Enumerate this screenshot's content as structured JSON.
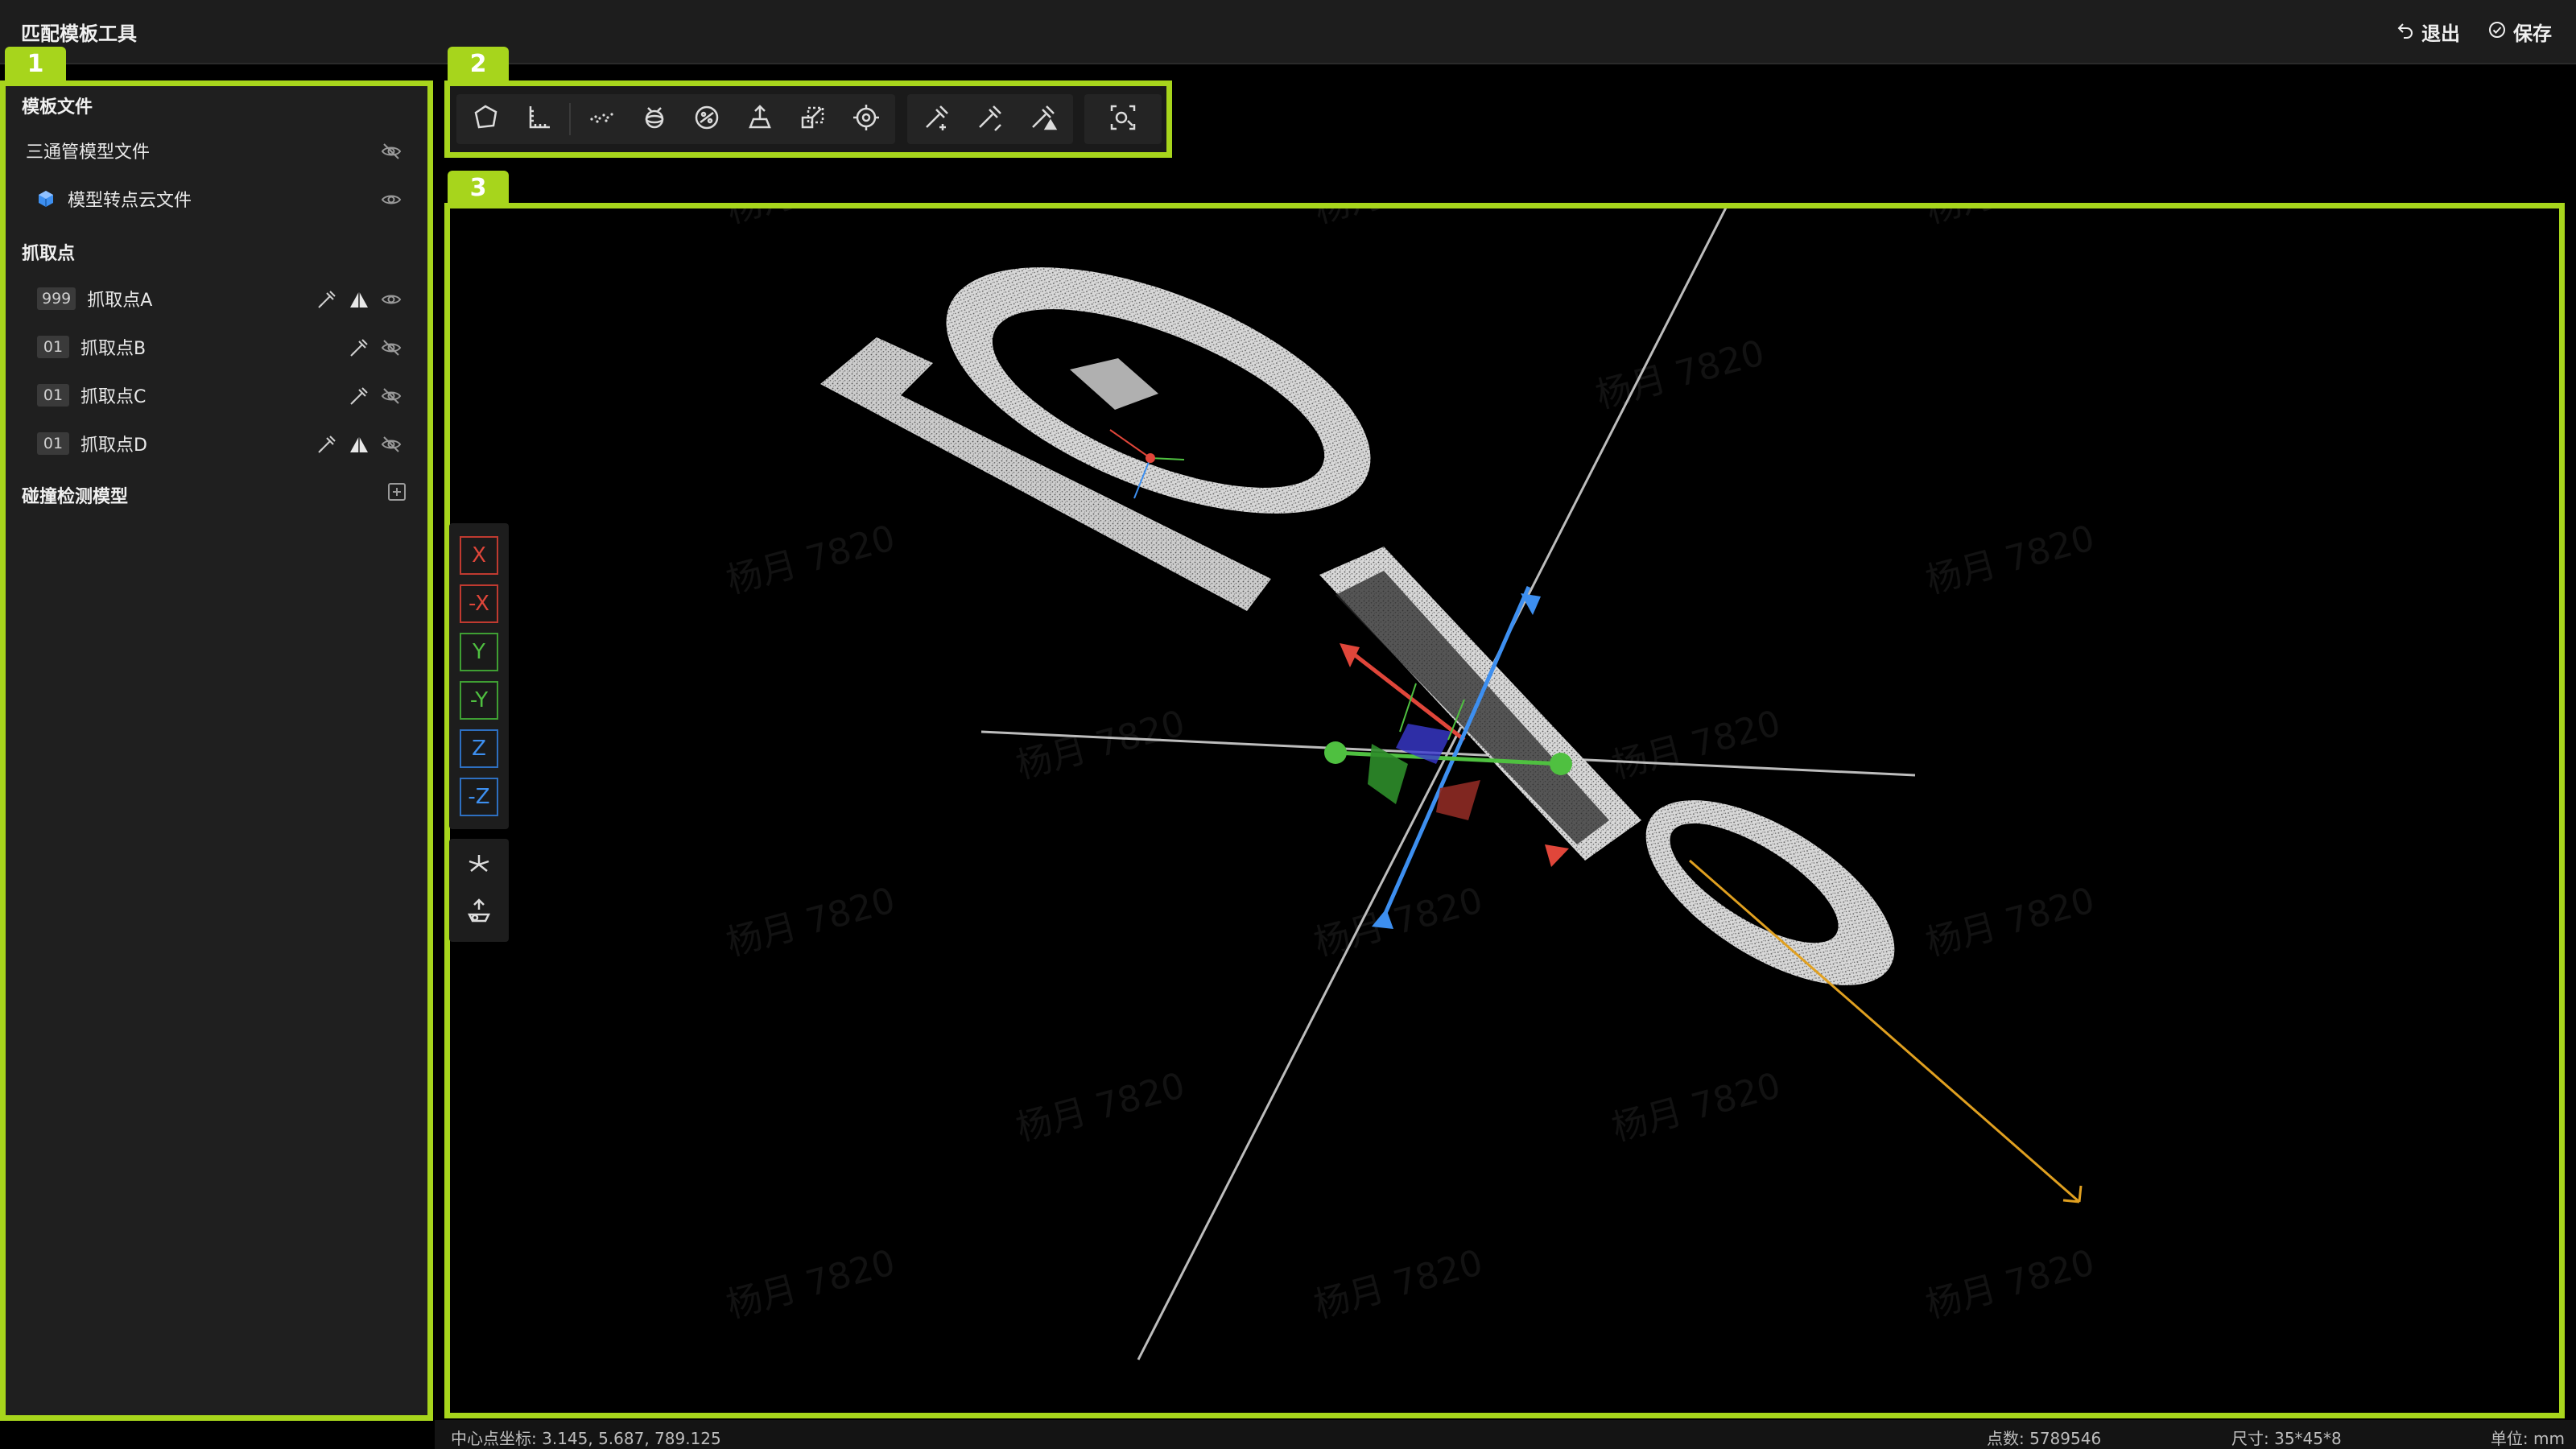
{
  "app": {
    "title": "匹配模板工具"
  },
  "header": {
    "exit_label": "退出",
    "save_label": "保存"
  },
  "regions": {
    "left": "1",
    "toolbar": "2",
    "viewport": "3"
  },
  "sidebar": {
    "template_section": "模板文件",
    "template_items": [
      {
        "label": "三通管模型文件",
        "visible": false
      },
      {
        "label": "模型转点云文件",
        "visible": true
      }
    ],
    "grab_section": "抓取点",
    "grab_points": [
      {
        "badge": "999",
        "label": "抓取点A",
        "visible": true,
        "has_warning": true
      },
      {
        "badge": "01",
        "label": "抓取点B",
        "visible": false,
        "has_warning": false
      },
      {
        "badge": "01",
        "label": "抓取点C",
        "visible": false,
        "has_warning": false
      },
      {
        "badge": "01",
        "label": "抓取点D",
        "visible": false,
        "has_warning": true
      }
    ],
    "collision_section": "碰撞检测模型"
  },
  "axis_buttons": [
    "X",
    "-X",
    "Y",
    "-Y",
    "Z",
    "-Z"
  ],
  "watermark_text": "杨月 7820",
  "status": {
    "center_label": "中心点坐标:",
    "center_value": "3.145,  5.687,  789.125",
    "points_label": "点数:",
    "points_value": "5789546",
    "size_label": "尺寸:",
    "size_value": "35*45*8",
    "unit_label": "单位:",
    "unit_value": "mm"
  },
  "colors": {
    "accent": "#a7d51c",
    "axis_x": "#e0463a",
    "axis_y": "#4fc040",
    "axis_z": "#3d8ff0",
    "vector": "#e0a020"
  }
}
